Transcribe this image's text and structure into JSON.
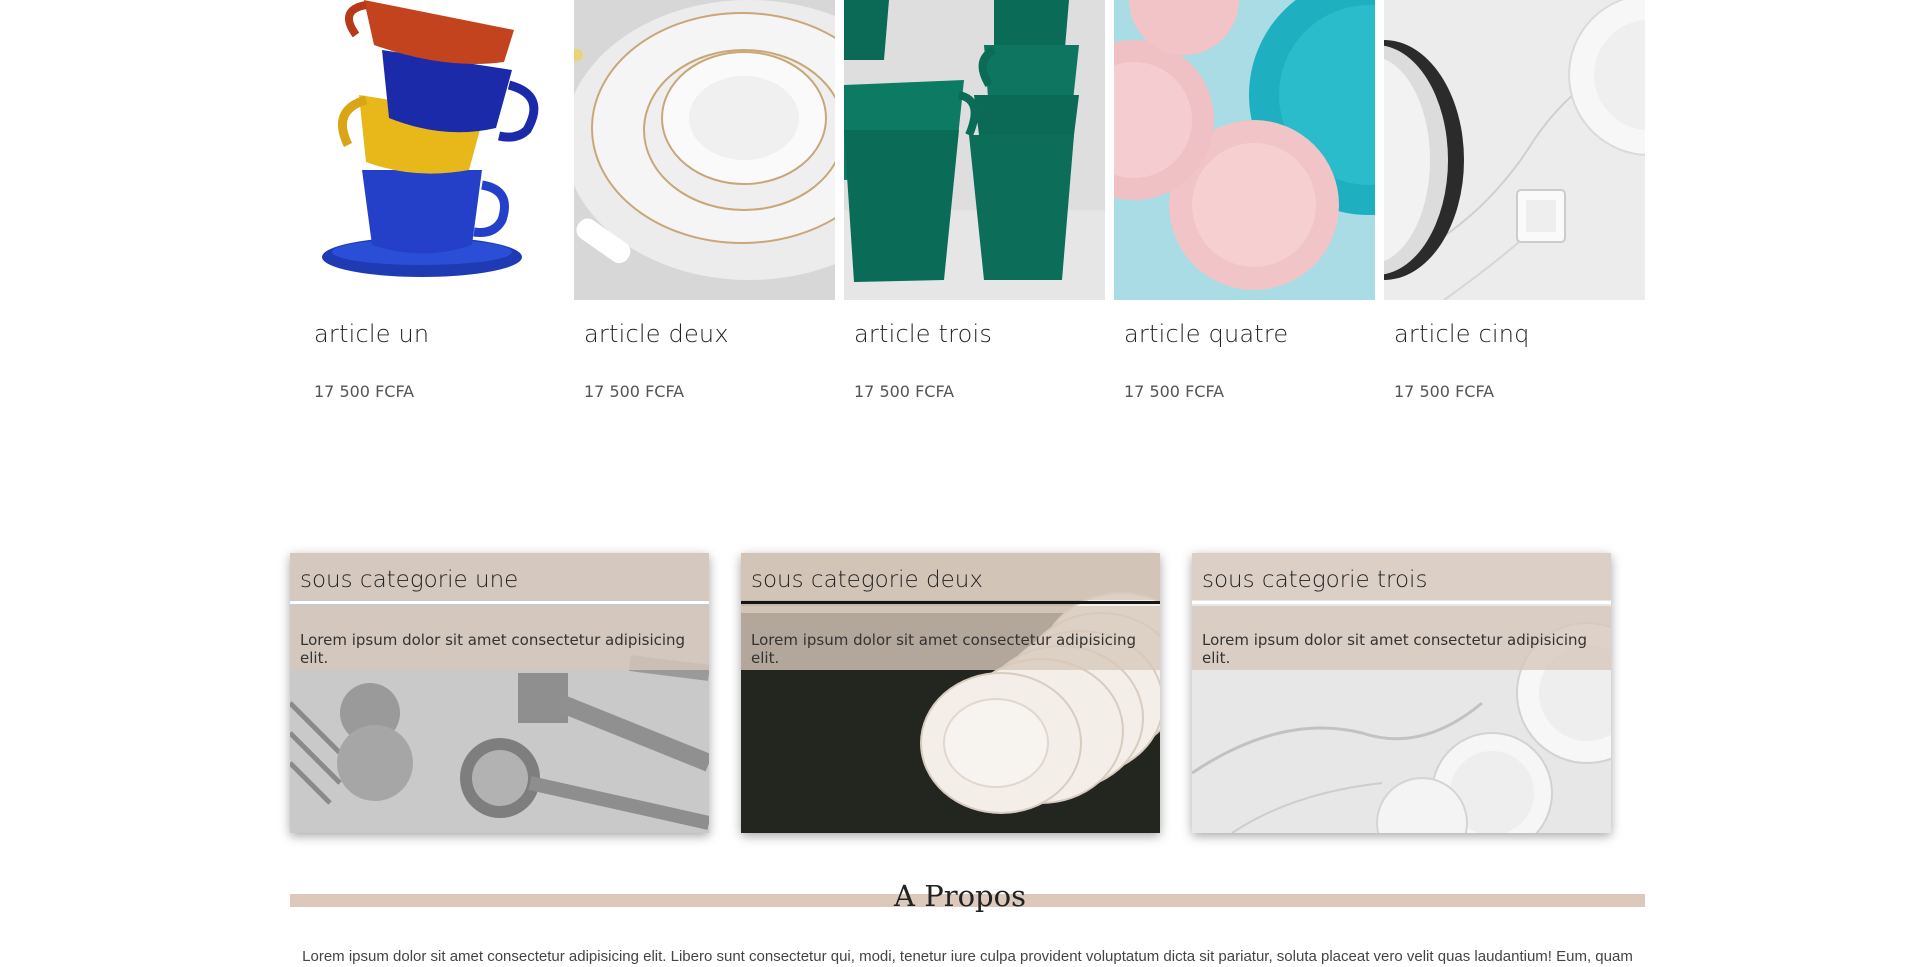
{
  "products": [
    {
      "name": "article un",
      "price": "17 500 FCFA",
      "image": "stacked-colorful-cups"
    },
    {
      "name": "article deux",
      "price": "17 500 FCFA",
      "image": "white-porcelain-plates"
    },
    {
      "name": "article trois",
      "price": "17 500 FCFA",
      "image": "green-mugs"
    },
    {
      "name": "article quatre",
      "price": "17 500 FCFA",
      "image": "pink-and-teal-plates"
    },
    {
      "name": "article cinq",
      "price": "17 500 FCFA",
      "image": "white-plates-on-marble"
    }
  ],
  "categories": [
    {
      "title": "sous categorie une",
      "text": "Lorem ipsum dolor sit amet consectetur adipisicing elit.",
      "image": "kitchen-utensils"
    },
    {
      "title": "sous categorie deux",
      "text": "Lorem ipsum dolor sit amet consectetur adipisicing elit.",
      "image": "paper-plates"
    },
    {
      "title": "sous categorie trois",
      "text": "Lorem ipsum dolor sit amet consectetur adipisicing elit.",
      "image": "plates-on-marble"
    }
  ],
  "about": {
    "title": "A Propos",
    "text": "Lorem ipsum dolor sit amet consectetur adipisicing elit. Libero sunt consectetur qui, modi, tenetur iure culpa provident voluptatum dicta sit pariatur, soluta placeat vero velit quas laudantium! Eum, quam"
  },
  "colors": {
    "accent_band": "#dcc9bb",
    "text": "#222222",
    "price": "#555555"
  }
}
